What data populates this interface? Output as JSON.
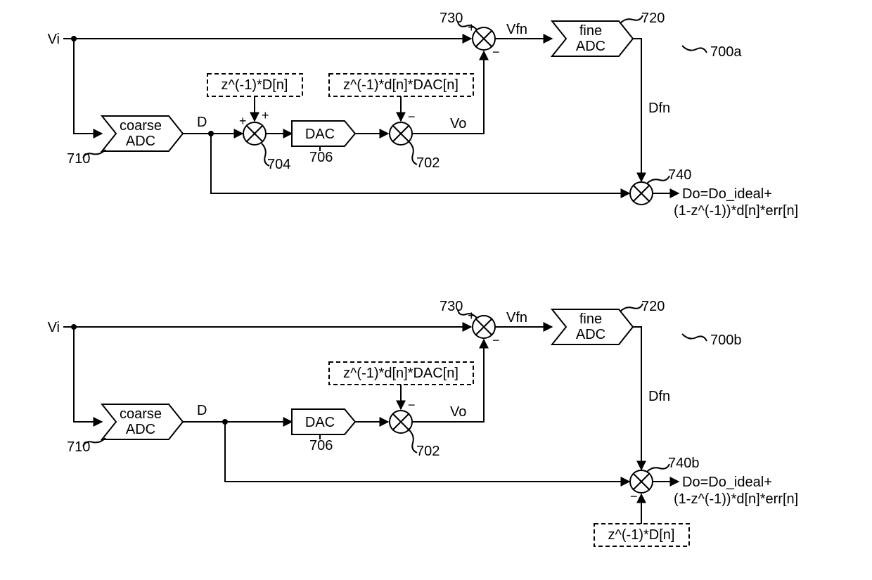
{
  "diagramA": {
    "ref": "700a",
    "input": "Vi",
    "coarse": {
      "line1": "coarse",
      "line2": "ADC",
      "ref": "710",
      "out": "D"
    },
    "sum704": {
      "ref": "704",
      "inj": "z^(-1)*D[n]"
    },
    "dac": {
      "label": "DAC",
      "ref": "706"
    },
    "sum702": {
      "ref": "702",
      "inj": "z^(-1)*d[n]*DAC[n]",
      "out": "Vo"
    },
    "sum730": {
      "ref": "730",
      "out": "Vfn"
    },
    "fine": {
      "line1": "fine",
      "line2": "ADC",
      "ref": "720",
      "out": "Dfn"
    },
    "sum740": {
      "ref": "740"
    },
    "output": {
      "line1": "Do=Do_ideal+",
      "line2": "(1-z^(-1))*d[n]*err[n]"
    }
  },
  "diagramB": {
    "ref": "700b",
    "input": "Vi",
    "coarse": {
      "line1": "coarse",
      "line2": "ADC",
      "ref": "710",
      "out": "D"
    },
    "dac": {
      "label": "DAC",
      "ref": "706"
    },
    "sum702": {
      "ref": "702",
      "inj": "z^(-1)*d[n]*DAC[n]",
      "out": "Vo"
    },
    "sum730": {
      "ref": "730",
      "out": "Vfn"
    },
    "fine": {
      "line1": "fine",
      "line2": "ADC",
      "ref": "720",
      "out": "Dfn"
    },
    "sum740b": {
      "ref": "740b",
      "inj": "z^(-1)*D[n]"
    },
    "output": {
      "line1": "Do=Do_ideal+",
      "line2": "(1-z^(-1))*d[n]*err[n]"
    }
  }
}
